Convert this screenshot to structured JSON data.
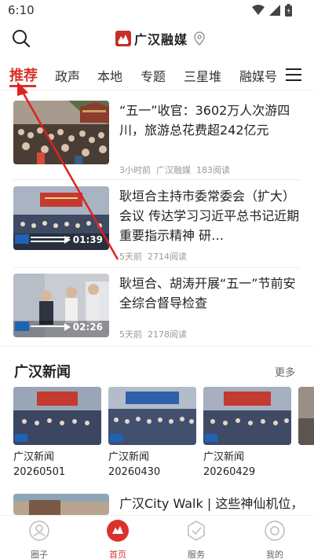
{
  "status": {
    "time": "6:10"
  },
  "header": {
    "brand": "广汉融媒",
    "brand_logo": "guanghan-logo"
  },
  "tabs": [
    {
      "label": "推荐",
      "active": true
    },
    {
      "label": "政声"
    },
    {
      "label": "本地"
    },
    {
      "label": "专题"
    },
    {
      "label": "三星堆"
    },
    {
      "label": "融媒号"
    }
  ],
  "news": [
    {
      "title": "“五一”收官：3602万人次游四川，旅游总花费超242亿元",
      "time": "3小时前",
      "source": "广汉融媒",
      "reads": "183阅读"
    },
    {
      "title": "耿垣合主持市委常委会（扩大）会议 传达学习习近平总书记近期重要指示精神 研…",
      "time": "5天前",
      "reads": "2714阅读",
      "duration": "01:39"
    },
    {
      "title": "耿垣合、胡涛开展“五一”节前安全综合督导检查",
      "time": "5天前",
      "reads": "2178阅读",
      "duration": "02:26"
    }
  ],
  "section": {
    "title": "广汉新闻",
    "more": "更多",
    "cards": [
      {
        "name": "广汉新闻",
        "date": "20260501"
      },
      {
        "name": "广汉新闻",
        "date": "20260430"
      },
      {
        "name": "广汉新闻",
        "date": "20260429"
      }
    ]
  },
  "partial_item": {
    "title": "广汉City Walk | 这些神仙机位，你知道几个？"
  },
  "bottom_nav": [
    {
      "label": "圈子",
      "icon": "circle-icon"
    },
    {
      "label": "首页",
      "icon": "home-icon",
      "active": true
    },
    {
      "label": "服务",
      "icon": "service-icon"
    },
    {
      "label": "我的",
      "icon": "profile-icon"
    }
  ],
  "colors": {
    "accent": "#d9322c",
    "text": "#222222",
    "meta": "#999999"
  }
}
